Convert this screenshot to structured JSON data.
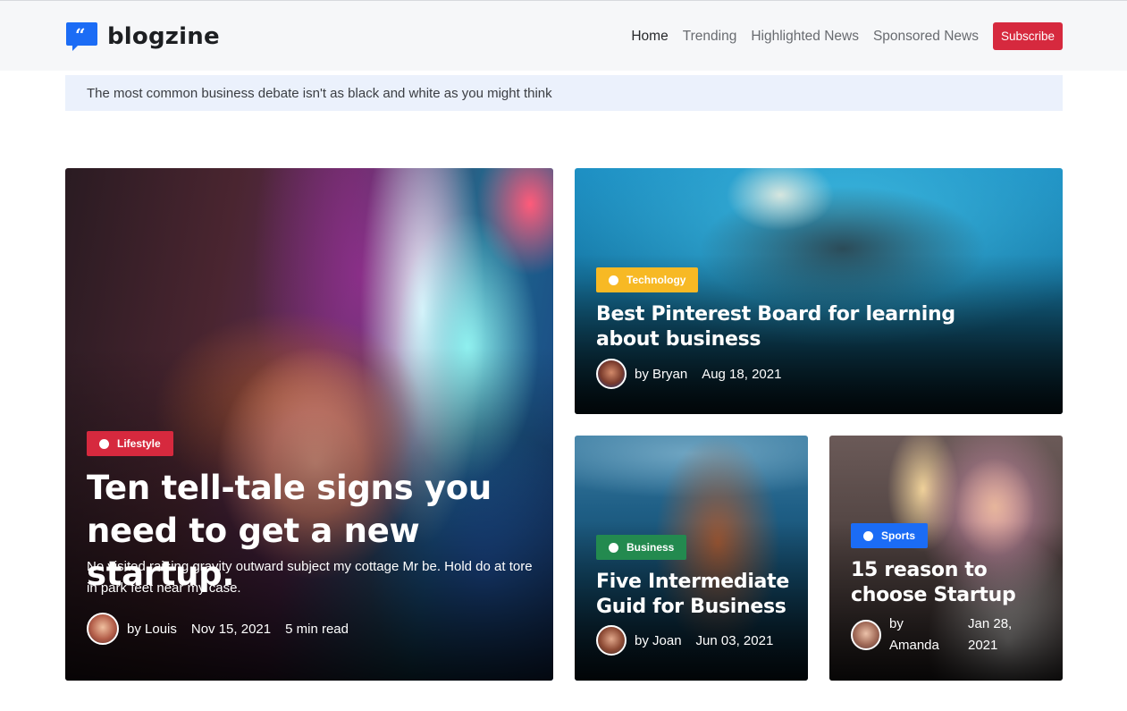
{
  "header": {
    "logo_text": "blogzine",
    "nav": [
      {
        "label": "Home"
      },
      {
        "label": "Trending"
      },
      {
        "label": "Highlighted News"
      },
      {
        "label": "Sponsored News"
      }
    ],
    "subscribe_label": "Subscribe"
  },
  "ticker": {
    "text": "The most common business debate isn't as black and white as you might think"
  },
  "cards": {
    "featured": {
      "category": "Lifestyle",
      "category_color": "#d6293e",
      "title": "Ten tell-tale signs you need to get a new startup.",
      "excerpt": "No visited raising gravity outward subject my cottage Mr be. Hold do at tore in park feet near my case.",
      "author": "by Louis",
      "date": "Nov 15, 2021",
      "read_time": "5 min read"
    },
    "top_right": {
      "category": "Technology",
      "category_color": "#f7b924",
      "title": "Best Pinterest Board for learning about business",
      "author": "by Bryan",
      "date": "Aug 18, 2021"
    },
    "bottom_left": {
      "category": "Business",
      "category_color": "#238a4f",
      "title": "Five Intermediate Guid for Business",
      "author": "by Joan",
      "date": "Jun 03, 2021"
    },
    "bottom_right": {
      "category": "Sports",
      "category_color": "#1b6cf5",
      "title": "15 reason to choose Startup",
      "author_line1": "by",
      "author_line2": "Amanda",
      "date_line1": "Jan 28,",
      "date_line2": "2021"
    }
  }
}
